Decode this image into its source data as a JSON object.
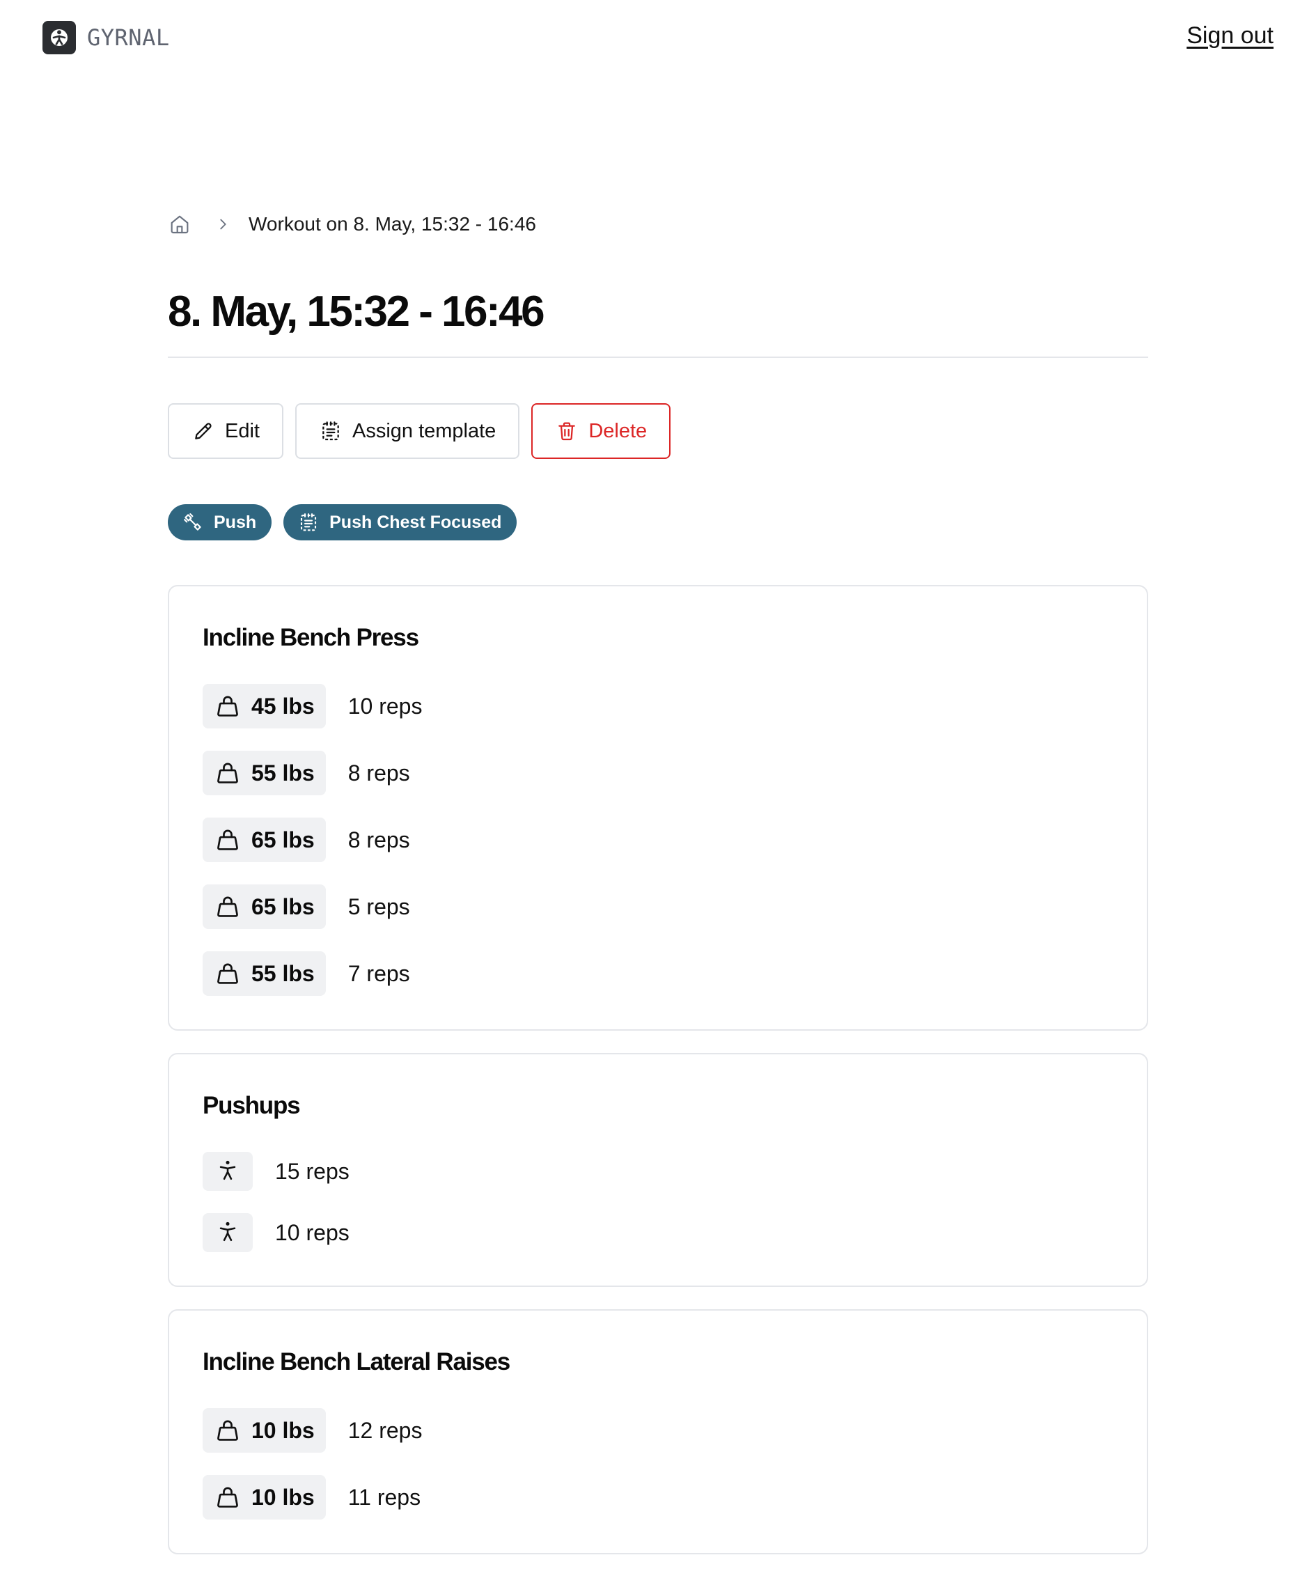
{
  "app": {
    "name": "GYRNAL",
    "sign_out": "Sign out"
  },
  "breadcrumb": {
    "current": "Workout on 8. May, 15:32 - 16:46"
  },
  "page_title": "8. May, 15:32 - 16:46",
  "actions": {
    "edit": "Edit",
    "assign_template": "Assign template",
    "delete": "Delete"
  },
  "colors": {
    "tag_bg": "#2f6680",
    "delete": "#dc2626",
    "chip_bg": "#f0f1f3",
    "logo_bg": "#2b2d31"
  },
  "tags": [
    {
      "label": "Push",
      "icon": "dumbbell-icon"
    },
    {
      "label": "Push Chest Focused",
      "icon": "template-icon"
    }
  ],
  "exercises": [
    {
      "name": "Incline Bench Press",
      "sets": [
        {
          "weight": "45 lbs",
          "reps": "10 reps"
        },
        {
          "weight": "55 lbs",
          "reps": "8 reps"
        },
        {
          "weight": "65 lbs",
          "reps": "8 reps"
        },
        {
          "weight": "65 lbs",
          "reps": "5 reps"
        },
        {
          "weight": "55 lbs",
          "reps": "7 reps"
        }
      ]
    },
    {
      "name": "Pushups",
      "sets": [
        {
          "reps": "15 reps"
        },
        {
          "reps": "10 reps"
        }
      ]
    },
    {
      "name": "Incline Bench Lateral Raises",
      "sets": [
        {
          "weight": "10 lbs",
          "reps": "12 reps"
        },
        {
          "weight": "10 lbs",
          "reps": "11 reps"
        }
      ]
    }
  ]
}
